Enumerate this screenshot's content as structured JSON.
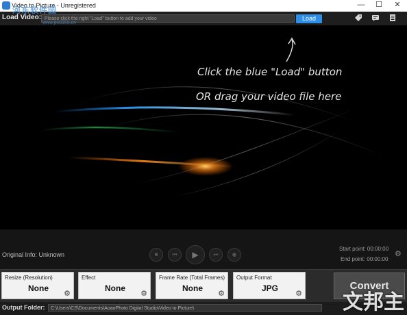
{
  "window": {
    "title": "Video to Picture - Unregistered",
    "minimize_glyph": "—",
    "maximize_glyph": "☐",
    "close_glyph": "✕"
  },
  "load_bar": {
    "label": "Load Video:",
    "placeholder": "Please click the right \"Load\" button to add your video",
    "load_button": "Load",
    "icons": [
      "tag-icon",
      "chat-icon",
      "list-icon"
    ]
  },
  "preview": {
    "hint_line1": "Click the blue \"Load\" button",
    "hint_line2": "OR drag your video file here"
  },
  "controls": {
    "original_info": "Original Info: Unknown",
    "start_point": "Start point: 00:00:00",
    "end_point": "End point: 00:00:00"
  },
  "panels": [
    {
      "title": "Resize (Resolution)",
      "value": "None"
    },
    {
      "title": "Effect",
      "value": "None"
    },
    {
      "title": "Frame Rate (Total Frames)",
      "value": "None"
    },
    {
      "title": "Output Format",
      "value": "JPG"
    }
  ],
  "convert_button": "Convert",
  "output": {
    "label": "Output Folder:",
    "path": "C:\\Users\\CS\\Documents\\AoaoPhoto Digital Studio\\Video to Picture\\"
  },
  "watermark": {
    "top": "河东软件园",
    "top_sub": "www.pc0359.cn",
    "bottom": "文邦主"
  },
  "colors": {
    "accent": "#2f8ee6",
    "background": "#000000",
    "panel": "#f2f2f2"
  }
}
